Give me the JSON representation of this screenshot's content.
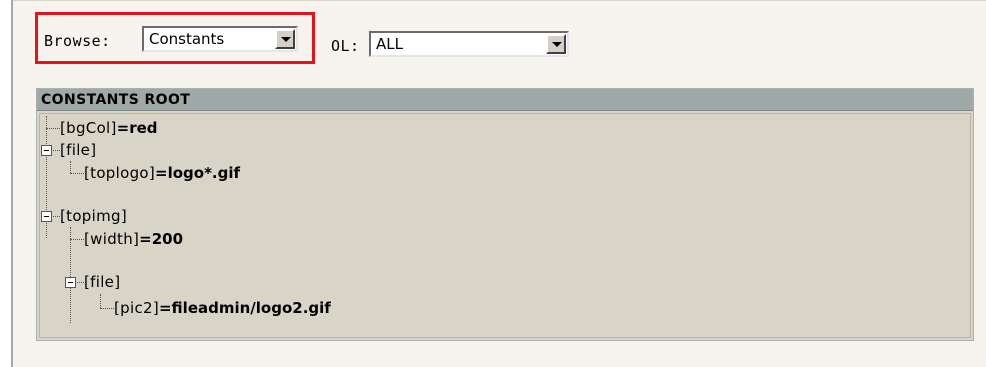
{
  "controls": {
    "browse_label": "Browse:",
    "browse_value": "Constants",
    "ol_label": "OL:",
    "ol_value": "ALL"
  },
  "tree": {
    "header": "CONSTANTS ROOT",
    "nodes": [
      {
        "key": "[bgCol]",
        "value": "=red"
      },
      {
        "key": "[file]",
        "value": ""
      },
      {
        "key": "[toplogo]",
        "value": "=logo*.gif"
      },
      {
        "key": "[topimg]",
        "value": ""
      },
      {
        "key": "[width]",
        "value": "=200"
      },
      {
        "key": "[file]",
        "value": ""
      },
      {
        "key": "[pic2]",
        "value": "=fileadmin/logo2.gif"
      }
    ]
  },
  "colors": {
    "highlight_border": "#e3141d",
    "header_bg": "#9faaa8",
    "tree_bg": "#d8d4c8",
    "panel_bg": "#f7f3ef"
  },
  "icons": {
    "select_arrow": "chevron-down-icon",
    "collapse": "minus-box-icon"
  }
}
